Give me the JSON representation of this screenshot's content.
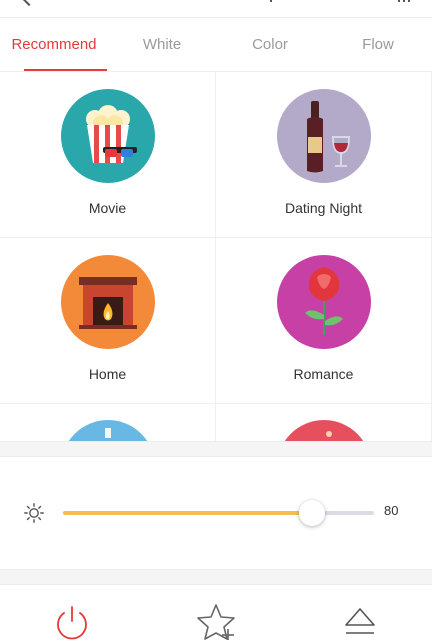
{
  "tabs": [
    {
      "label": "Recommend",
      "active": true
    },
    {
      "label": "White",
      "active": false
    },
    {
      "label": "Color",
      "active": false
    },
    {
      "label": "Flow",
      "active": false
    }
  ],
  "scenes": [
    {
      "label": "Movie",
      "icon": "popcorn-icon",
      "color": "#2aa7aa"
    },
    {
      "label": "Dating Night",
      "icon": "wine-icon",
      "color": "#b3a9c9"
    },
    {
      "label": "Home",
      "icon": "fireplace-icon",
      "color": "#f38a3a"
    },
    {
      "label": "Romance",
      "icon": "rose-icon",
      "color": "#c640a6"
    }
  ],
  "partial_scenes": [
    {
      "icon": "partial-scene-icon",
      "color": "#69b7e3"
    },
    {
      "icon": "partial-scene-icon",
      "color": "#e6505e"
    }
  ],
  "brightness": {
    "value": "80",
    "level": 0.8,
    "fill_color": "#f2c04a"
  },
  "colors": {
    "accent": "#e23b3b",
    "power": "#e23b3b"
  }
}
